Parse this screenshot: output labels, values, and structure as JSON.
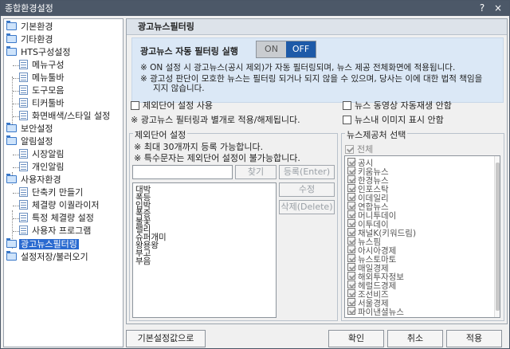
{
  "window": {
    "title": "종합환경설정",
    "help_glyph": "?",
    "close_glyph": "×"
  },
  "tree": {
    "items": [
      {
        "label": "기본환경"
      },
      {
        "label": "기타환경"
      },
      {
        "label": "HTS구성설정"
      },
      {
        "label": "메뉴구성"
      },
      {
        "label": "메뉴툴바"
      },
      {
        "label": "도구모음"
      },
      {
        "label": "티커툴바"
      },
      {
        "label": "화면배색/스타일 설정"
      },
      {
        "label": "보안설정"
      },
      {
        "label": "알림설정"
      },
      {
        "label": "시장알림"
      },
      {
        "label": "개인알림"
      },
      {
        "label": "사용자환경"
      },
      {
        "label": "단축키 만들기"
      },
      {
        "label": "체결량 이퀄라이저"
      },
      {
        "label": "특정 체결량 설정"
      },
      {
        "label": "사용자 프로그램"
      },
      {
        "label": "광고뉴스필터링"
      },
      {
        "label": "설정저장/불러오기"
      }
    ],
    "selected": "광고뉴스필터링"
  },
  "panel": {
    "title": "광고뉴스필터링",
    "filter_label": "광고뉴스 자동 필터링 실행",
    "toggle": {
      "on_label": "ON",
      "off_label": "OFF",
      "state": "OFF"
    },
    "notes": [
      "※ ON 설정 시 광고뉴스(공시 제외)가 자동 필터링되며, 뉴스 제공 전체화면에 적용됩니다.",
      "※ 광고성 판단이 모호한 뉴스는 필터링 되거나 되지 않을 수 있으며, 당사는 이에 대한 법적 책임을",
      "지지 않습니다."
    ],
    "options": {
      "use_exclude": "제외단어 설정 사용",
      "video_autoplay": "뉴스 동영상 자동재생 안함",
      "separate_note": "※ 광고뉴스 필터링과 별개로 적용/해제됩니다.",
      "hide_images": "뉴스내 이미지 표시 안함"
    },
    "exclude": {
      "group_title": "제외단어 설정",
      "note1": "※ 최대 30개까지 등록 가능합니다.",
      "note2": "※ 특수문자는 제외단어 설정이 불가능합니다.",
      "input_value": "",
      "find_button": "찾기",
      "register_button": "등록(Enter)",
      "edit_button": "수정",
      "delete_button": "삭제(Delete)",
      "words": [
        "대박",
        "폭등",
        "입박",
        "폭증",
        "불꽃",
        "랠리",
        "슈퍼개미",
        "왕용왕",
        "부고",
        "부음"
      ]
    },
    "sources": {
      "group_title": "뉴스제공처 선택",
      "all_label": "전체",
      "items": [
        "공시",
        "키움뉴스",
        "한경뉴스",
        "인포스탁",
        "이데일리",
        "연합뉴스",
        "머니투데이",
        "이투데이",
        "채널K(키워드림)",
        "뉴스핌",
        "아시아경제",
        "뉴스토마토",
        "매일경제",
        "해외투자정보",
        "헤럴드경제",
        "조선비즈",
        "서울경제",
        "파이낸셜뉴스"
      ]
    }
  },
  "footer": {
    "reset_button": "기본설정값으로",
    "ok_button": "확인",
    "cancel_button": "취소",
    "apply_button": "적용"
  }
}
